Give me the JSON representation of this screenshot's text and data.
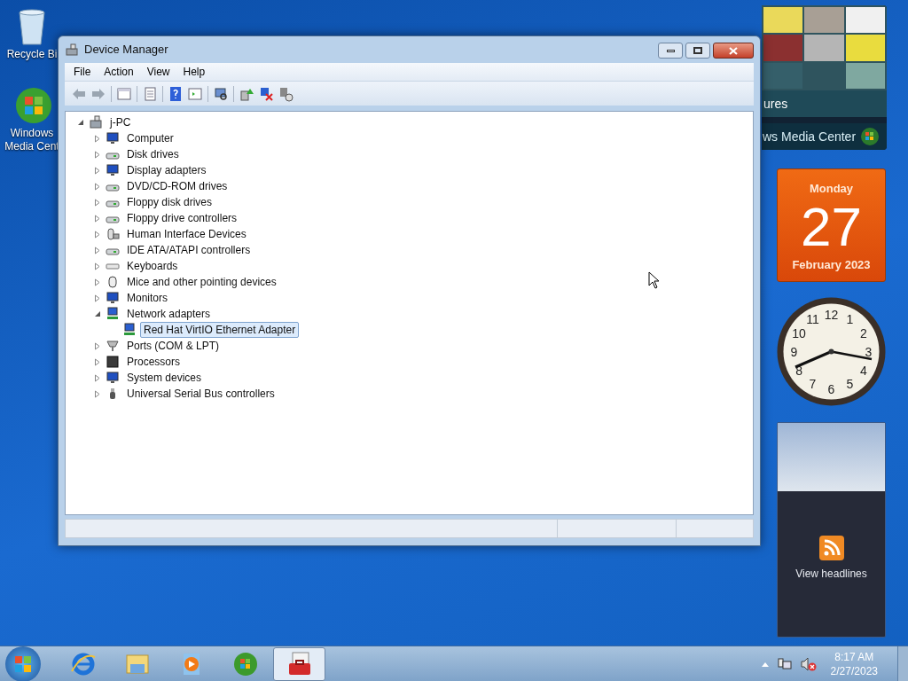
{
  "desktop_icons": [
    {
      "kind": "recycle-bin",
      "lines": [
        "Recycle Bi"
      ]
    },
    {
      "kind": "media-center",
      "lines": [
        "Windows",
        "Media Cent"
      ]
    }
  ],
  "window": {
    "title": "Device Manager",
    "menu": [
      "File",
      "Action",
      "View",
      "Help"
    ],
    "toolbar": [
      {
        "kind": "back"
      },
      {
        "kind": "forward"
      },
      {
        "kind": "sep"
      },
      {
        "kind": "tree-pane"
      },
      {
        "kind": "sep"
      },
      {
        "kind": "properties"
      },
      {
        "kind": "sep"
      },
      {
        "kind": "help"
      },
      {
        "kind": "action-pane"
      },
      {
        "kind": "sep"
      },
      {
        "kind": "scan"
      },
      {
        "kind": "sep"
      },
      {
        "kind": "update"
      },
      {
        "kind": "uninstall"
      },
      {
        "kind": "disable"
      }
    ],
    "tree": [
      {
        "label": "j-PC",
        "kind": "pc",
        "expanded": true,
        "selected": false,
        "children": [
          {
            "label": "Computer",
            "kind": "monitor",
            "expanded": false,
            "selected": false
          },
          {
            "label": "Disk drives",
            "kind": "drive",
            "expanded": false,
            "selected": false
          },
          {
            "label": "Display adapters",
            "kind": "monitor",
            "expanded": false,
            "selected": false
          },
          {
            "label": "DVD/CD-ROM drives",
            "kind": "drive",
            "expanded": false,
            "selected": false
          },
          {
            "label": "Floppy disk drives",
            "kind": "drive",
            "expanded": false,
            "selected": false
          },
          {
            "label": "Floppy drive controllers",
            "kind": "drive",
            "expanded": false,
            "selected": false
          },
          {
            "label": "Human Interface Devices",
            "kind": "hid",
            "expanded": false,
            "selected": false
          },
          {
            "label": "IDE ATA/ATAPI controllers",
            "kind": "drive",
            "expanded": false,
            "selected": false
          },
          {
            "label": "Keyboards",
            "kind": "keyboard",
            "expanded": false,
            "selected": false
          },
          {
            "label": "Mice and other pointing devices",
            "kind": "mouse",
            "expanded": false,
            "selected": false
          },
          {
            "label": "Monitors",
            "kind": "monitor",
            "expanded": false,
            "selected": false
          },
          {
            "label": "Network adapters",
            "kind": "network",
            "expanded": true,
            "selected": false,
            "children": [
              {
                "label": "Red Hat VirtIO Ethernet Adapter",
                "kind": "network",
                "selected": true
              }
            ]
          },
          {
            "label": "Ports (COM & LPT)",
            "kind": "port",
            "expanded": false,
            "selected": false
          },
          {
            "label": "Processors",
            "kind": "cpu",
            "expanded": false,
            "selected": false
          },
          {
            "label": "System devices",
            "kind": "monitor",
            "expanded": false,
            "selected": false
          },
          {
            "label": "Universal Serial Bus controllers",
            "kind": "usb",
            "expanded": false,
            "selected": false
          }
        ]
      }
    ]
  },
  "gadgets": {
    "media_center": {
      "caption": "ures",
      "banner": "ws Media Center"
    },
    "calendar": {
      "weekday": "Monday",
      "day": "27",
      "month": "February 2023"
    },
    "clock": {
      "numbers": [
        "11",
        "12",
        "1",
        "10",
        "2",
        "9",
        "3",
        "8",
        "4",
        "7",
        "6",
        "5"
      ]
    },
    "feed": {
      "label": "View headlines"
    }
  },
  "taskbar": {
    "items": [
      {
        "kind": "browser",
        "selected": false
      },
      {
        "kind": "folder",
        "selected": false
      },
      {
        "kind": "media-player",
        "selected": false
      },
      {
        "kind": "media-center",
        "selected": false
      },
      {
        "kind": "toolbox",
        "selected": true
      }
    ],
    "time": "8:17 AM",
    "date": "2/27/2023"
  }
}
